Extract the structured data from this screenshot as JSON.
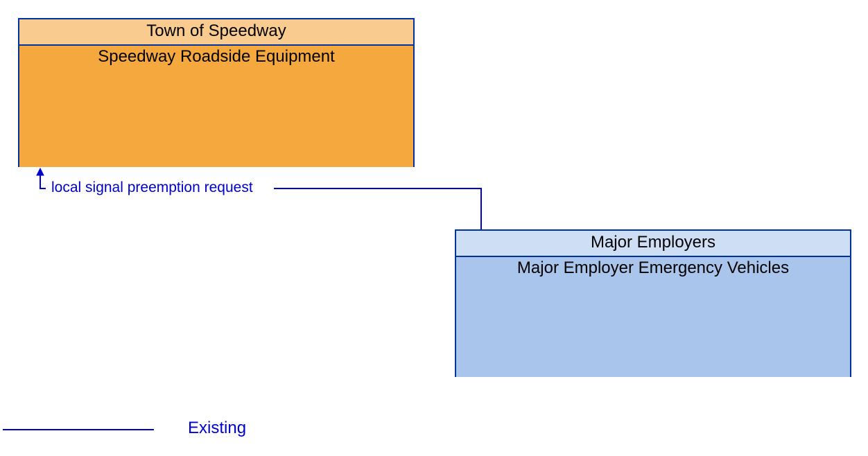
{
  "nodes": {
    "speedway": {
      "header": "Town of Speedway",
      "body": "Speedway Roadside Equipment",
      "border_color": "#003399",
      "header_bg": "#f9cb8f",
      "body_bg": "#f5a83e"
    },
    "employers": {
      "header": "Major Employers",
      "body": "Major Employer Emergency Vehicles",
      "border_color": "#003399",
      "header_bg": "#cedff5",
      "body_bg": "#a9c5eb"
    }
  },
  "flows": {
    "preempt": {
      "label": "local signal preemption request",
      "color": "#0000cc"
    }
  },
  "legend": {
    "existing": "Existing"
  },
  "chart_data": {
    "type": "diagram",
    "entities": [
      {
        "id": "speedway_roadside_equipment",
        "owner": "Town of Speedway",
        "name": "Speedway Roadside Equipment"
      },
      {
        "id": "major_employer_emergency_vehicles",
        "owner": "Major Employers",
        "name": "Major Employer Emergency Vehicles"
      }
    ],
    "flows": [
      {
        "from": "major_employer_emergency_vehicles",
        "to": "speedway_roadside_equipment",
        "label": "local signal preemption request",
        "status": "Existing"
      }
    ],
    "legend": [
      {
        "status": "Existing",
        "style": "solid-blue-line"
      }
    ]
  }
}
